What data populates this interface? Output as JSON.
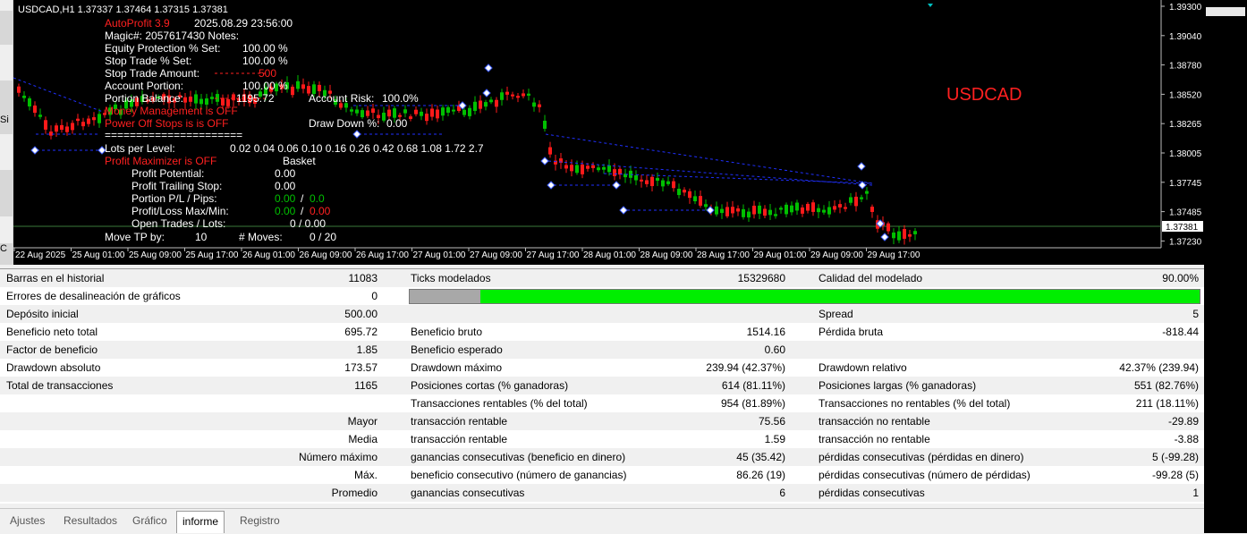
{
  "chart": {
    "symbol_header": "USDCAD,H1  1.37337 1.37464 1.37315 1.37381",
    "big_symbol": "USDCAD",
    "current_price": "1.37381",
    "price_levels": [
      "1.39300",
      "1.39040",
      "1.38780",
      "1.38520",
      "1.38265",
      "1.38005",
      "1.37745",
      "1.37485",
      "1.37230"
    ],
    "time_labels": [
      "22 Aug 2025",
      "25 Aug 01:00",
      "25 Aug 09:00",
      "25 Aug 17:00",
      "26 Aug 01:00",
      "26 Aug 09:00",
      "26 Aug 17:00",
      "27 Aug 01:00",
      "27 Aug 09:00",
      "27 Aug 17:00",
      "28 Aug 01:00",
      "28 Aug 09:00",
      "28 Aug 17:00",
      "29 Aug 01:00",
      "29 Aug 09:00",
      "29 Aug 17:00"
    ],
    "left_strip_labels": [
      "Si",
      "C"
    ],
    "overlay": {
      "title": "AutoProfit 3.9",
      "datetime": "2025.08.29 23:56:00",
      "magic": "Magic#: 2057617430    Notes:",
      "equity_protection_label": "Equity Protection % Set:",
      "equity_protection_value": "100.00 %",
      "stop_trade_pct_label": "Stop Trade % Set:",
      "stop_trade_pct_value": "100.00 %",
      "stop_trade_amount_label": "Stop Trade Amount:",
      "stop_trade_amount_value": "500",
      "account_portion_label": "Account Portion:",
      "account_portion_value": "100.00 %",
      "portion_balance_label": "Portion Balance:",
      "portion_balance_value": "1195.72",
      "account_risk_label": "Account Risk:",
      "account_risk_value": "100.0%",
      "money_management": "Money Management is OFF",
      "power_off_stops": "Power Off Stops is is OFF",
      "drawdown_label": "Draw Down %:",
      "drawdown_value": "0.00",
      "separator": "======================",
      "lots_per_level_label": "Lots per Level:",
      "lots_per_level_values": "0.02  0.04  0.06  0.10  0.16  0.26  0.42  0.68  1.08  1.72  2.7",
      "profit_maximizer": "Profit Maximizer is OFF",
      "basket": "Basket",
      "profit_potential_label": "Profit Potential:",
      "profit_potential_value": "0.00",
      "profit_trailing_label": "Profit Trailing Stop:",
      "profit_trailing_value": "0.00",
      "portion_pl_label": "Portion P/L / Pips:",
      "portion_pl_value1": "0.00",
      "portion_pl_sep": "/",
      "portion_pl_value2": "0.0",
      "pl_maxmin_label": "Profit/Loss Max/Min:",
      "pl_maxmin_value1": "0.00",
      "pl_maxmin_sep": "/",
      "pl_maxmin_value2": "0.00",
      "open_trades_label": "Open Trades / Lots:",
      "open_trades_value": "0  /  0.00",
      "move_tp_label": "Move TP by:",
      "move_tp_value": "10",
      "moves_label": "# Moves:",
      "moves_value": "0  /  20"
    }
  },
  "stats": {
    "r1": {
      "a_label": "Barras en el historial",
      "a_value": "11083",
      "b_label": "Ticks modelados",
      "b_value": "15329680",
      "c_label": "Calidad del modelado",
      "c_value": "90.00%"
    },
    "r2": {
      "a_label": "Errores de desalineación de gráficos",
      "a_value": "0",
      "modeling_quality_fraction": 0.91
    },
    "r3": {
      "a_label": "Depósito inicial",
      "a_value": "500.00",
      "c_label": "Spread",
      "c_value": "5"
    },
    "r4": {
      "a_label": "Beneficio neto total",
      "a_value": "695.72",
      "b_label": "Beneficio bruto",
      "b_value": "1514.16",
      "c_label": "Pérdida bruta",
      "c_value": "-818.44"
    },
    "r5": {
      "a_label": "Factor de beneficio",
      "a_value": "1.85",
      "b_label": "Beneficio esperado",
      "b_value": "0.60"
    },
    "r6": {
      "a_label": "Drawdown absoluto",
      "a_value": "173.57",
      "b_label": "Drawdown máximo",
      "b_value": "239.94 (42.37%)",
      "c_label": "Drawdown relativo",
      "c_value": "42.37% (239.94)"
    },
    "r7": {
      "a_label": "Total de transacciones",
      "a_value": "1165",
      "b_label": "Posiciones cortas (% ganadoras)",
      "b_value": "614 (81.11%)",
      "c_label": "Posiciones largas (% ganadoras)",
      "c_value": "551 (82.76%)"
    },
    "r8": {
      "b_label": "Transacciones rentables (% del total)",
      "b_value": "954 (81.89%)",
      "c_label": "Transacciones no rentables (% del total)",
      "c_value": "211 (18.11%)"
    },
    "r9": {
      "a_value": "Mayor",
      "b_label": "transacción rentable",
      "b_value": "75.56",
      "c_label": "transacción no rentable",
      "c_value": "-29.89"
    },
    "r10": {
      "a_value": "Media",
      "b_label": "transacción rentable",
      "b_value": "1.59",
      "c_label": "transacción no rentable",
      "c_value": "-3.88"
    },
    "r11": {
      "a_value": "Número máximo",
      "b_label": "ganancias consecutivas (beneficio en dinero)",
      "b_value": "45 (35.42)",
      "c_label": "pérdidas consecutivas (pérdidas en dinero)",
      "c_value": "5 (-99.28)"
    },
    "r12": {
      "a_value": "Máx.",
      "b_label": "beneficio consecutivo (número de ganancias)",
      "b_value": "86.26 (19)",
      "c_label": "pérdidas consecutivas (número de pérdidas)",
      "c_value": "-99.28 (5)"
    },
    "r13": {
      "a_value": "Promedio",
      "b_label": "ganancias consecutivas",
      "b_value": "6",
      "c_label": "pérdidas consecutivas",
      "c_value": "1"
    }
  },
  "tabs": [
    "Ajustes",
    "Resultados",
    "Gráfico",
    "informe",
    "Registro"
  ],
  "active_tab": "informe",
  "colors": {
    "bull": "#00c000",
    "bear": "#ff1a1a",
    "accent_red": "#ff2020",
    "progress_green": "#00ee00",
    "grid_line": "#3a7a3a"
  }
}
